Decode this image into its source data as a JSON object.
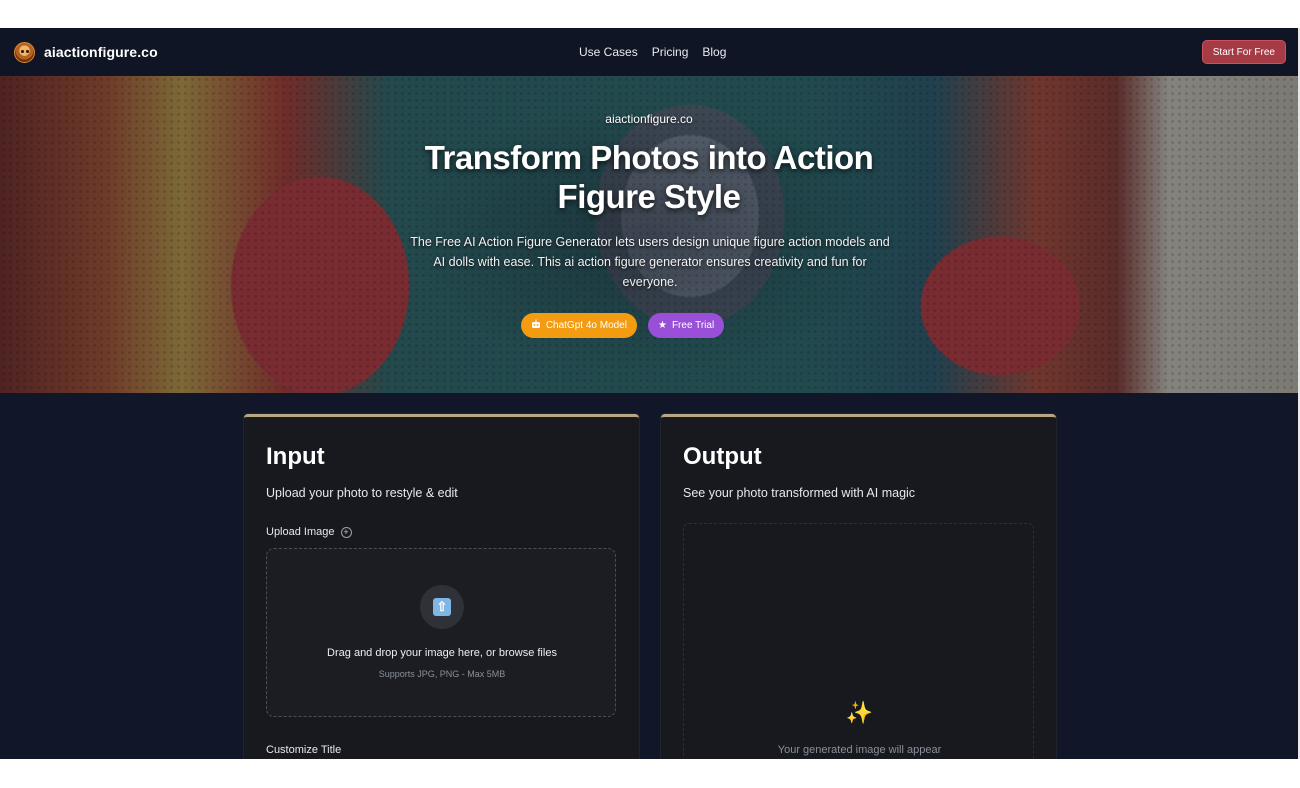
{
  "brand": {
    "name": "aiactionfigure.co",
    "logo_icon": "mascot-logo-icon"
  },
  "nav": {
    "links": [
      "Use Cases",
      "Pricing",
      "Blog"
    ],
    "cta": "Start For Free"
  },
  "hero": {
    "eyebrow": "aiactionfigure.co",
    "title": "Transform Photos into Action Figure Style",
    "description": "The Free AI Action Figure Generator lets users design unique figure action models and AI dolls with ease. This ai action figure generator ensures creativity and fun for everyone.",
    "buttons": [
      {
        "label": "ChatGpt 4o Model",
        "icon": "robot-icon",
        "color": "#f39c12"
      },
      {
        "label": "Free Trial",
        "icon": "star-icon",
        "color": "#9a4fd8"
      }
    ]
  },
  "input_card": {
    "title": "Input",
    "subtitle": "Upload your photo to restyle & edit",
    "upload_label": "Upload Image",
    "dropzone_text": "Drag and drop your image here, or browse files",
    "dropzone_hint": "Supports JPG, PNG - Max 5MB",
    "customize_label": "Customize Title"
  },
  "output_card": {
    "title": "Output",
    "subtitle": "See your photo transformed with AI magic",
    "placeholder": "Your generated image will appear"
  },
  "colors": {
    "background": "#111729",
    "accent_cta": "#a53b45",
    "card_border": "#b8a583"
  }
}
